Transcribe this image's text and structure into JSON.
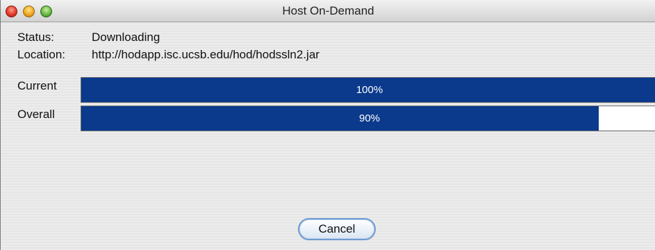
{
  "window": {
    "title": "Host On-Demand"
  },
  "status": {
    "label": "Status:",
    "value": "Downloading"
  },
  "location": {
    "label": "Location:",
    "value": "http://hodapp.isc.ucsb.edu/hod/hodssln2.jar"
  },
  "progress": {
    "current": {
      "label": "Current",
      "percent_text": "100%",
      "value": 1.0
    },
    "overall": {
      "label": "Overall",
      "percent_text": "90%",
      "value": 0.9
    }
  },
  "buttons": {
    "cancel": "Cancel"
  },
  "colors": {
    "bar_fill": "#0b3a8c",
    "window_bg": "#ebebeb"
  }
}
